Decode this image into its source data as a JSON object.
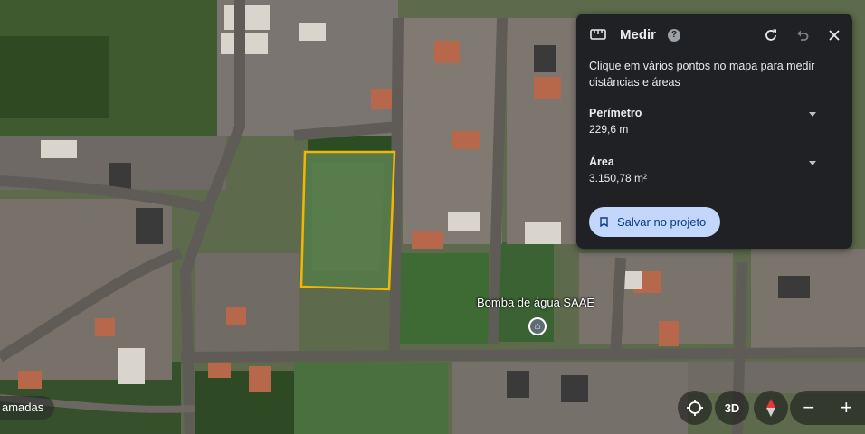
{
  "panel": {
    "title": "Medir",
    "description": "Clique em vários pontos no mapa para medir distâncias e áreas",
    "perimeter_label": "Perímetro",
    "perimeter_value": "229,6 m",
    "area_label": "Área",
    "area_value": "3.150,78 m²",
    "save_label": "Salvar no projeto",
    "help_icon": "?"
  },
  "map": {
    "poi_label": "Bomba de água SAAE",
    "layers_label": "amadas",
    "measure_outline_color": "#f2b705"
  },
  "controls": {
    "view_3d_label": "3D",
    "zoom_out_label": "−",
    "zoom_in_label": "+"
  }
}
